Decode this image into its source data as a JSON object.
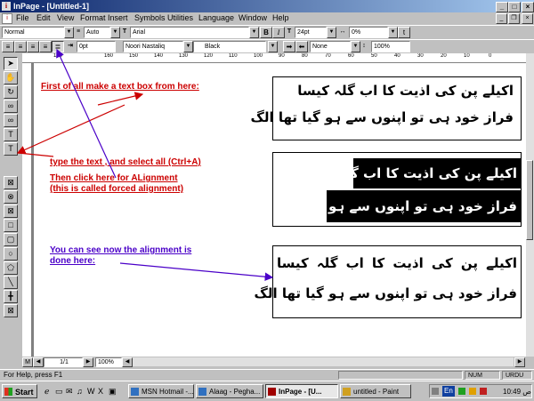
{
  "window": {
    "title": "InPage - [Untitled-1]"
  },
  "menu": {
    "items": [
      "File",
      "Edit",
      "View",
      "Format",
      "Insert",
      "Symbols",
      "Utilities",
      "Language",
      "Window",
      "Help"
    ]
  },
  "toolbar1": {
    "style": "Normal",
    "leading": "Auto",
    "font": "Arial",
    "bold": "B",
    "italic": "I",
    "size": "24pt",
    "scale": "0%",
    "text_tool": "t"
  },
  "toolbar2": {
    "indent": "0pt",
    "urdu_font": "Noori Nastaliq",
    "color": "Black",
    "shade": "None",
    "zoom": "100%"
  },
  "ruler": {
    "labels": [
      "180",
      "160",
      "150",
      "140",
      "130",
      "120",
      "110",
      "100",
      "90",
      "80",
      "70",
      "60",
      "50",
      "40",
      "30",
      "20",
      "10",
      "0"
    ]
  },
  "annotations": {
    "step1": "First of all make a text box from here:",
    "step2": "type the text , and select all (Ctrl+A)",
    "step3_line1": "Then click here for ALignment",
    "step3_line2": "(this is called forced alignment)",
    "step4_line1": "You can see now the alignment is",
    "step4_line2": "done here:"
  },
  "textboxes": {
    "box1": {
      "line1": "اکیلے پن کی اذیت کا اب گلہ کیسا",
      "line2": "فراز خود ہی تو اپنوں سے ہو گیا تھا الگ"
    },
    "box2": {
      "line1": "اکیلے پن کی اذیت کا اب گلہ کیسا",
      "line2": "فراز خود ہی تو اپنوں سے ہو گیا تھا الگ"
    },
    "box3": {
      "line1": "اکیلے پن کی اذیت کا اب گلہ کیسا",
      "line2": "فراز خود ہی تو اپنوں سے ہو گیا تھا الگ"
    }
  },
  "navbar": {
    "page": "1/1",
    "zoom": "100%",
    "m": "M"
  },
  "status": {
    "help": "For Help, press F1",
    "num": "NUM",
    "urdu": "URDU"
  },
  "taskbar": {
    "start": "Start",
    "buttons": [
      "MSN Hotmail -...",
      "Alaag - Pegha...",
      "InPage - [U...",
      "untitled - Paint"
    ],
    "lang": "En",
    "clock": "10:49 ص"
  },
  "colors": {
    "annotation_red": "#cc0000",
    "annotation_blue": "#4a00c8",
    "titlebar": "#0a246a"
  }
}
